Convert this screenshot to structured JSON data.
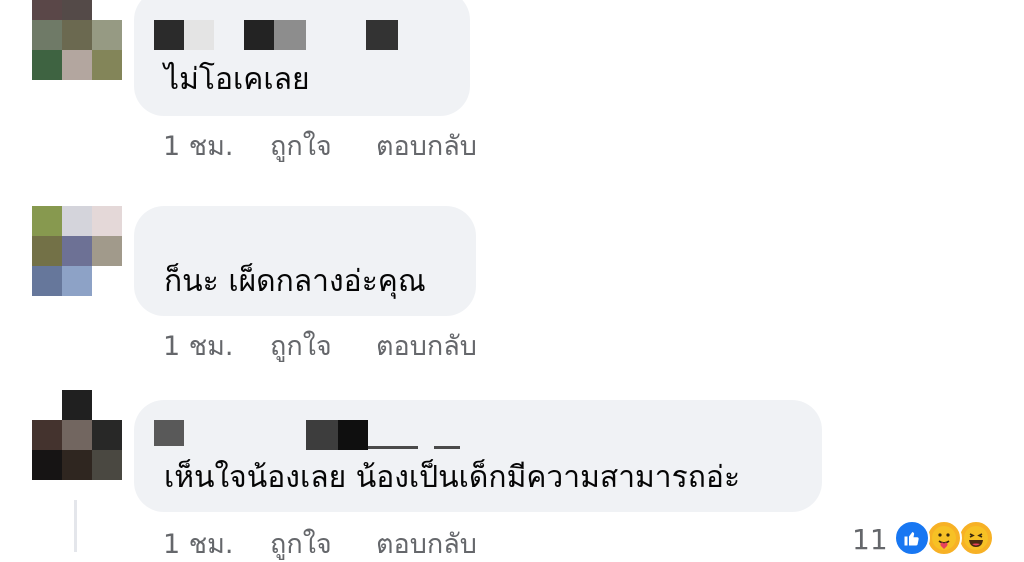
{
  "comments": [
    {
      "text": "ไม่โอเคเลย",
      "time": "1 ชม.",
      "like": "ถูกใจ",
      "reply": "ตอบกลับ",
      "avatar_colors": [
        "#5a4748",
        "#544a48",
        "#ffffff",
        "#6f7a67",
        "#6b6950",
        "#969a83",
        "#3e6341",
        "#b3a69f",
        "#838559"
      ],
      "name_colors": [
        "#2b2b2b",
        "#e4e4e4",
        "#232323",
        "#8d8d8d",
        "#333333"
      ]
    },
    {
      "text": "ก็นะ เผ็ดกลางอ่ะคุณ",
      "time": "1 ชม.",
      "like": "ถูกใจ",
      "reply": "ตอบกลับ",
      "avatar_colors": [
        "#87994f",
        "#d4d4db",
        "#e4d8d8",
        "#737147",
        "#6d7195",
        "#a19a8b",
        "#66779b",
        "#8da2c6",
        "#ffffff"
      ],
      "name_colors": []
    },
    {
      "text": "เห็นใจน้องเลย น้องเป็นเด็กมีความสามารถอ่ะ",
      "time": "1 ชม.",
      "like": "ถูกใจ",
      "reply": "ตอบกลับ",
      "avatar_colors": [
        "#ffffff",
        "#202020",
        "#ffffff",
        "#44332e",
        "#726660",
        "#282827",
        "#161414",
        "#2f2620",
        "#4a4841"
      ],
      "name_colors": [
        "#595959",
        "#f2f2f2",
        "#3d3d3d",
        "#0f0f0f",
        "#4a4a4a"
      ],
      "reaction_count": "11",
      "reaction_icons": [
        "like-icon",
        "care-icon",
        "haha-icon"
      ]
    }
  ],
  "colors": {
    "bubble": "#f0f2f5",
    "meta_text": "#65676b",
    "body_text": "#050505",
    "like_blue": "#1877f2"
  }
}
